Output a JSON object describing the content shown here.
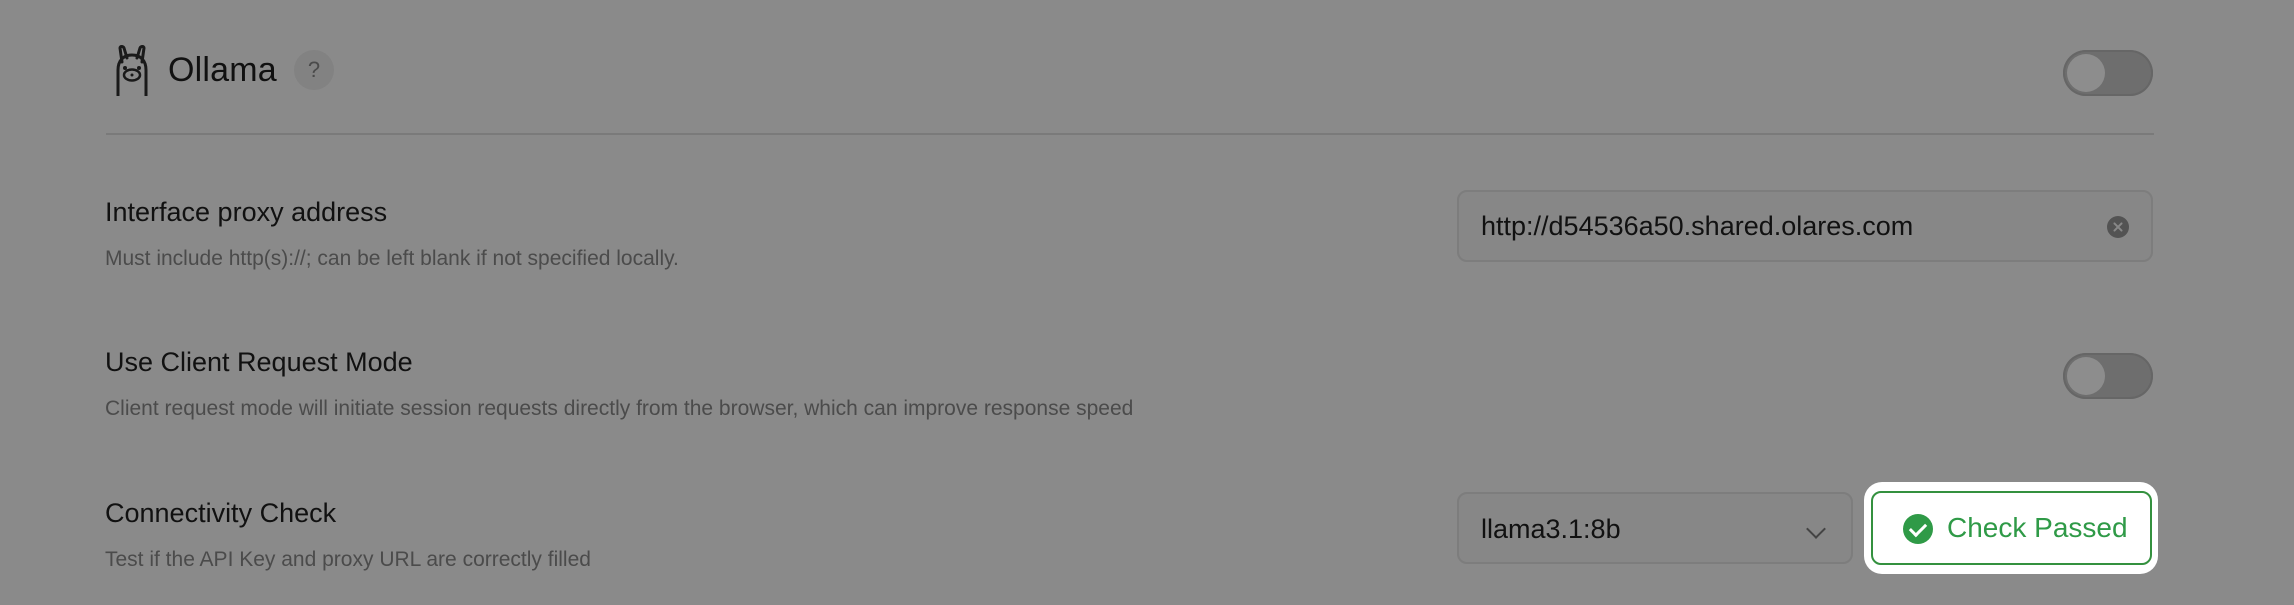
{
  "provider": {
    "name": "Ollama",
    "help": "?",
    "logo_icon": "ollama-llama-icon",
    "enabled": false
  },
  "proxy": {
    "title": "Interface proxy address",
    "description": "Must include http(s)://; can be left blank if not specified locally.",
    "value": "http://d54536a50.shared.olares.com",
    "clear_icon": "clear-icon"
  },
  "client_mode": {
    "title": "Use Client Request Mode",
    "description": "Client request mode will initiate session requests directly from the browser, which can improve response speed",
    "enabled": false
  },
  "connectivity": {
    "title": "Connectivity Check",
    "description": "Test if the API Key and proxy URL are correctly filled",
    "model": "llama3.1:8b",
    "check_label": "Check Passed",
    "check_icon": "check-circle-icon"
  },
  "colors": {
    "background": "#8a8a8a",
    "success": "#2f9a47",
    "text": "#111111",
    "muted_text": "#4b4b4b"
  }
}
